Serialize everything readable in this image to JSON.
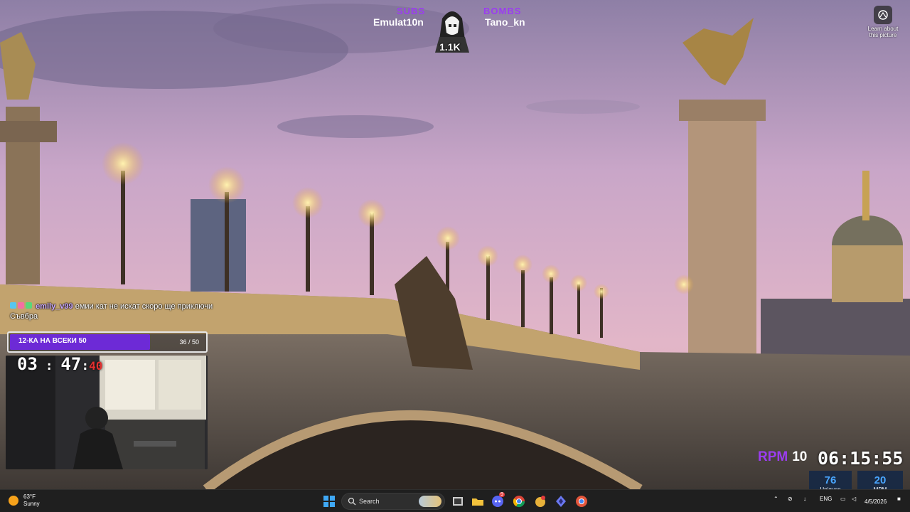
{
  "overlay": {
    "subs_label": "SUBS",
    "subs_name": "Emulat10n",
    "bombs_label": "BOMBS",
    "bombs_name": "Tano_kn",
    "mascot_count": "1.1K"
  },
  "desktop": {
    "learn_about_picture": "Learn about this picture",
    "learn_icon": "camera-lens-icon"
  },
  "chat": {
    "username": "emily_v99",
    "message": "емии кат не искат скоро ще приключи Съвбра"
  },
  "goal": {
    "label": "12-КА НА ВСЕКИ 50",
    "count": "36 / 50",
    "progress": 0.72,
    "fill_color": "#6d2ad6"
  },
  "timer": {
    "hours": "03",
    "minutes": "47",
    "seconds": "40"
  },
  "stats": {
    "rpm_label": "RPM",
    "rpm_value": "10",
    "clock": "06:15:55",
    "uniques_value": "76",
    "uniques_label": "Uniques",
    "mpm_value": "20",
    "mpm_label": "MPM"
  },
  "taskbar": {
    "weather_temp": "63°F",
    "weather_cond": "Sunny",
    "search_placeholder": "Search",
    "language": "ENG",
    "date": "4/5/2026",
    "discord_badge": "9",
    "icons": [
      "windows-start-icon",
      "search-icon",
      "task-view-icon",
      "file-explorer-icon",
      "discord-icon",
      "chrome-icon",
      "app-icon",
      "edge-app-icon",
      "chrome-beta-icon"
    ]
  },
  "colors": {
    "accent_purple": "#9b3df0",
    "stat_blue": "#4aa6ff",
    "taskbar_bg": "#1f1f1f"
  }
}
